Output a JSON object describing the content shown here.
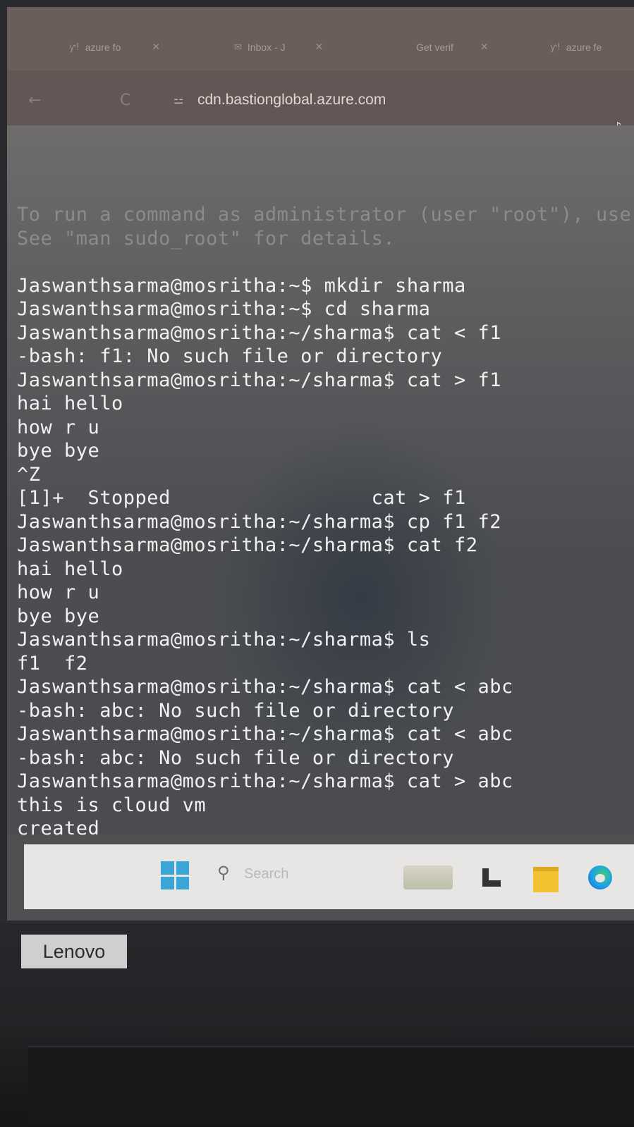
{
  "browser": {
    "tabs": [
      {
        "label": "azure fo",
        "favicon": "ƴ!"
      },
      {
        "label": "Inbox - J",
        "favicon": "✉"
      },
      {
        "label": "Get verif",
        "favicon": ""
      },
      {
        "label": "azure fe",
        "favicon": "ƴ!"
      }
    ],
    "url": "cdn.bastionglobal.azure.com",
    "back_icon": "←",
    "reload_icon": "C",
    "site_info_icon": "⚍",
    "extension_icon": "♪",
    "tab_close_icon": "✕"
  },
  "terminal": {
    "lines": [
      {
        "text": "To run a command as administrator (user \"root\"), use",
        "faded": true
      },
      {
        "text": "See \"man sudo_root\" for details.",
        "faded": true
      },
      {
        "text": "",
        "faded": false
      },
      {
        "text": "Jaswanthsarma@mosritha:~$ mkdir sharma",
        "faded": false
      },
      {
        "text": "Jaswanthsarma@mosritha:~$ cd sharma",
        "faded": false
      },
      {
        "text": "Jaswanthsarma@mosritha:~/sharma$ cat < f1",
        "faded": false
      },
      {
        "text": "-bash: f1: No such file or directory",
        "faded": false
      },
      {
        "text": "Jaswanthsarma@mosritha:~/sharma$ cat > f1",
        "faded": false
      },
      {
        "text": "hai hello",
        "faded": false
      },
      {
        "text": "how r u",
        "faded": false
      },
      {
        "text": "bye bye",
        "faded": false
      },
      {
        "text": "^Z",
        "faded": false
      },
      {
        "text": "[1]+  Stopped                 cat > f1",
        "faded": false
      },
      {
        "text": "Jaswanthsarma@mosritha:~/sharma$ cp f1 f2",
        "faded": false
      },
      {
        "text": "Jaswanthsarma@mosritha:~/sharma$ cat f2",
        "faded": false
      },
      {
        "text": "hai hello",
        "faded": false
      },
      {
        "text": "how r u",
        "faded": false
      },
      {
        "text": "bye bye",
        "faded": false
      },
      {
        "text": "Jaswanthsarma@mosritha:~/sharma$ ls",
        "faded": false
      },
      {
        "text": "f1  f2",
        "faded": false
      },
      {
        "text": "Jaswanthsarma@mosritha:~/sharma$ cat < abc",
        "faded": false
      },
      {
        "text": "-bash: abc: No such file or directory",
        "faded": false
      },
      {
        "text": "Jaswanthsarma@mosritha:~/sharma$ cat < abc",
        "faded": false
      },
      {
        "text": "-bash: abc: No such file or directory",
        "faded": false
      },
      {
        "text": "Jaswanthsarma@mosritha:~/sharma$ cat > abc",
        "faded": false
      },
      {
        "text": "this is cloud vm",
        "faded": false
      },
      {
        "text": "created",
        "faded": false
      }
    ]
  },
  "taskbar": {
    "search_placeholder": "Search",
    "search_icon": "⚲"
  },
  "laptop": {
    "brand": "Lenovo"
  }
}
